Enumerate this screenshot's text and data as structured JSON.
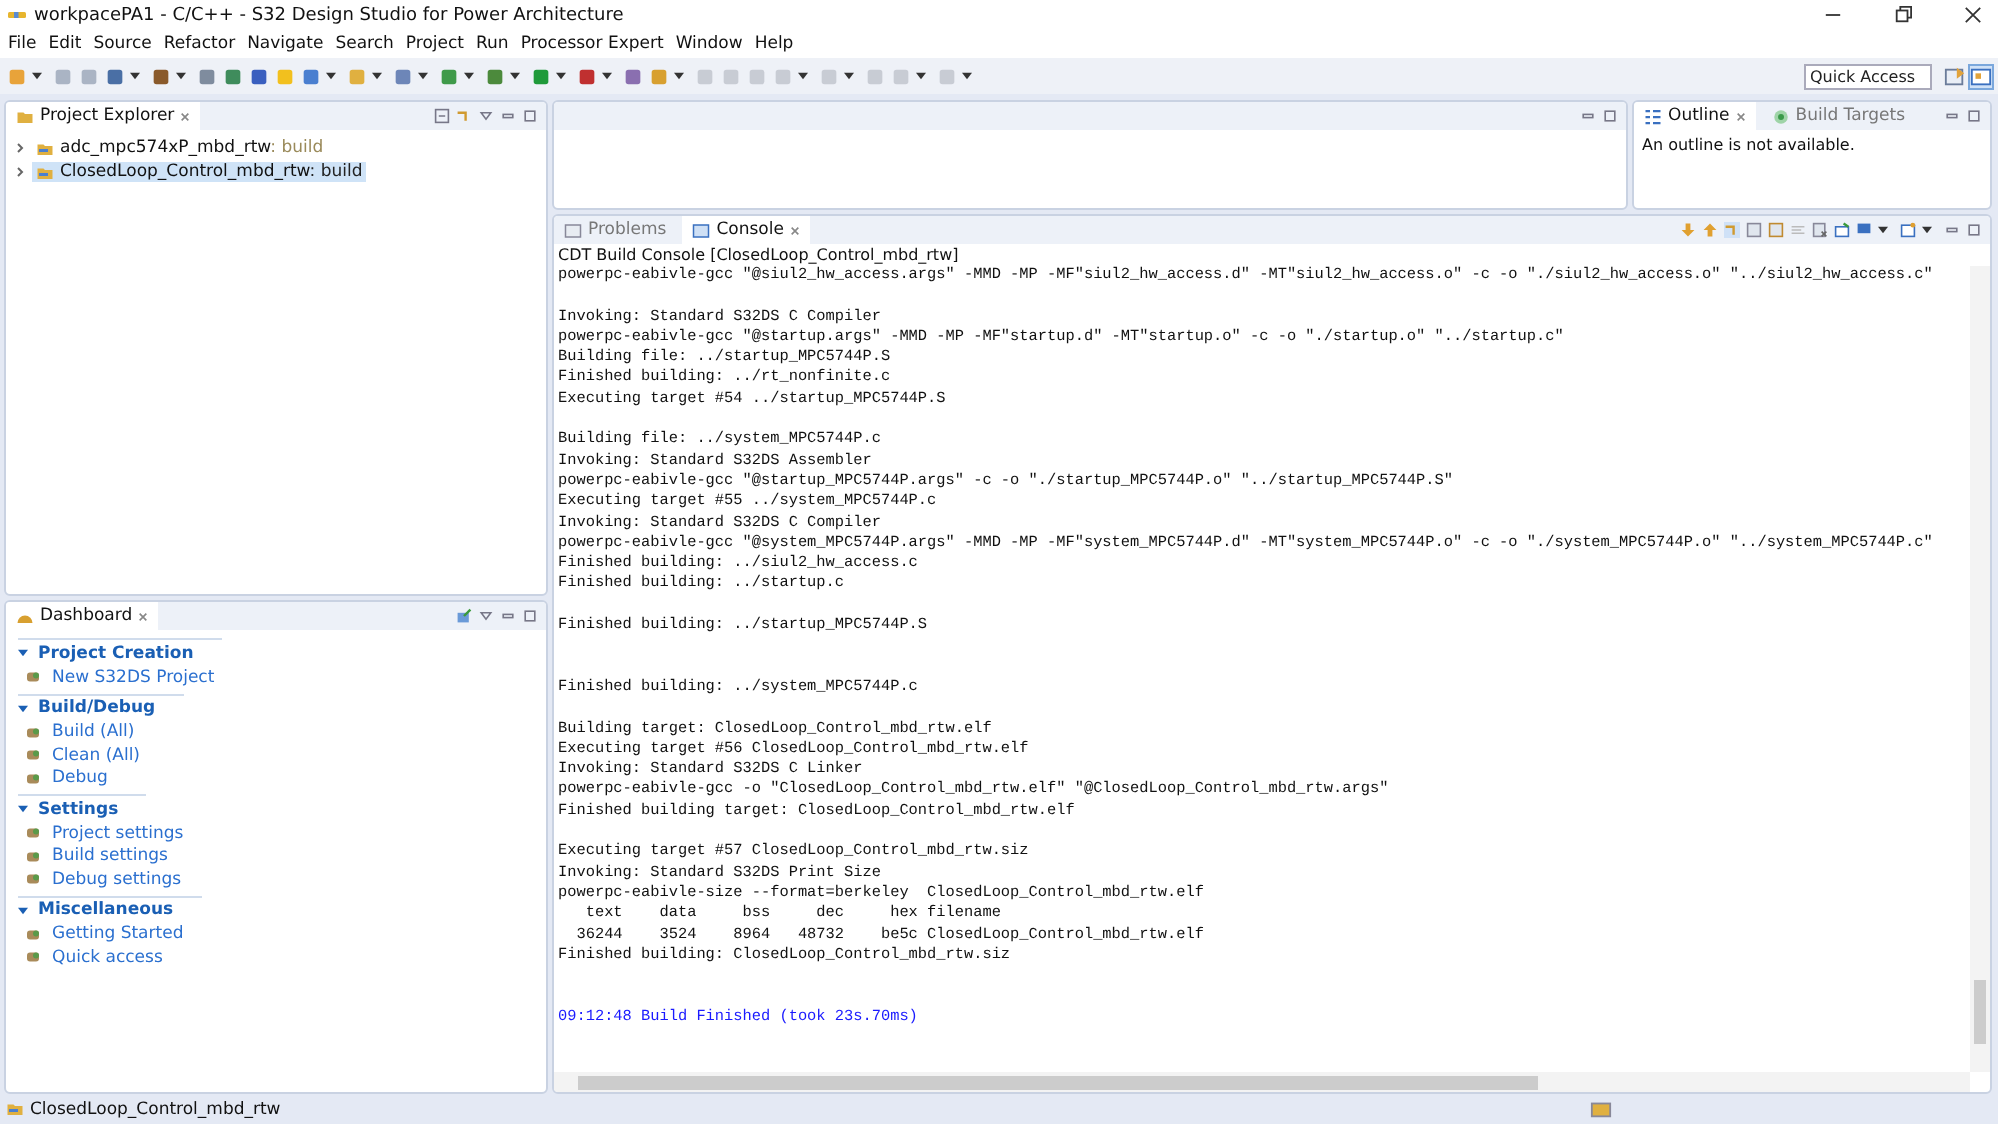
{
  "window": {
    "title": "workpacePA1 - C/C++ - S32 Design Studio for Power Architecture"
  },
  "menu": [
    "File",
    "Edit",
    "Source",
    "Refactor",
    "Navigate",
    "Search",
    "Project",
    "Run",
    "Processor Expert",
    "Window",
    "Help"
  ],
  "quick_access": {
    "placeholder": "Quick Access"
  },
  "project_explorer": {
    "title": "Project Explorer",
    "items": [
      {
        "name": "adc_mpc574xP_mbd_rtw",
        "decoration": ": build",
        "selected": false,
        "expanded": false
      },
      {
        "name": "ClosedLoop_Control_mbd_rtw",
        "decoration": ": build",
        "selected": true,
        "expanded": false
      }
    ]
  },
  "outline": {
    "tabs": [
      {
        "label": "Outline",
        "selected": true
      },
      {
        "label": "Build Targets",
        "selected": false
      }
    ],
    "message": "An outline is not available."
  },
  "dashboard": {
    "title": "Dashboard",
    "sections": [
      {
        "title": "Project Creation",
        "expanded": true,
        "items": [
          "New S32DS Project"
        ]
      },
      {
        "title": "Build/Debug",
        "expanded": true,
        "items": [
          "Build  (All)",
          "Clean  (All)",
          "Debug"
        ]
      },
      {
        "title": "Settings",
        "expanded": true,
        "items": [
          "Project settings",
          "Build settings",
          "Debug settings"
        ]
      },
      {
        "title": "Miscellaneous",
        "expanded": true,
        "items": [
          "Getting Started",
          "Quick access"
        ]
      }
    ]
  },
  "console_tabs": [
    {
      "label": "Problems",
      "selected": false
    },
    {
      "label": "Console",
      "selected": true
    }
  ],
  "console": {
    "title": "CDT Build Console [ClosedLoop_Control_mbd_rtw]",
    "lines": [
      {
        "kind": "text",
        "text": "powerpc-eabivle-gcc \"@siul2_hw_access.args\" -MMD -MP -MF\"siul2_hw_access.d\" -MT\"siul2_hw_access.o\" -c -o \"./siul2_hw_access.o\" \"../siul2_hw_access.c\""
      },
      {
        "kind": "blank"
      },
      {
        "kind": "text",
        "text": "Invoking: Standard S32DS C Compiler"
      },
      {
        "kind": "text",
        "text": "powerpc-eabivle-gcc \"@startup.args\" -MMD -MP -MF\"startup.d\" -MT\"startup.o\" -c -o \"./startup.o\" \"../startup.c\""
      },
      {
        "kind": "text",
        "text": "Building file: ../startup_MPC5744P.S"
      },
      {
        "kind": "text",
        "text": "Finished building: ../rt_nonfinite.c"
      },
      {
        "kind": "text",
        "text": "Executing target #54 ../startup_MPC5744P.S"
      },
      {
        "kind": "blank"
      },
      {
        "kind": "text",
        "text": "Building file: ../system_MPC5744P.c"
      },
      {
        "kind": "text",
        "text": "Invoking: Standard S32DS Assembler"
      },
      {
        "kind": "text",
        "text": "powerpc-eabivle-gcc \"@startup_MPC5744P.args\" -c -o \"./startup_MPC5744P.o\" \"../startup_MPC5744P.S\""
      },
      {
        "kind": "text",
        "text": "Executing target #55 ../system_MPC5744P.c"
      },
      {
        "kind": "text",
        "text": "Invoking: Standard S32DS C Compiler"
      },
      {
        "kind": "text",
        "text": "powerpc-eabivle-gcc \"@system_MPC5744P.args\" -MMD -MP -MF\"system_MPC5744P.d\" -MT\"system_MPC5744P.o\" -c -o \"./system_MPC5744P.o\" \"../system_MPC5744P.c\""
      },
      {
        "kind": "text",
        "text": "Finished building: ../siul2_hw_access.c"
      },
      {
        "kind": "text",
        "text": "Finished building: ../startup.c"
      },
      {
        "kind": "blank"
      },
      {
        "kind": "text",
        "text": "Finished building: ../startup_MPC5744P.S"
      },
      {
        "kind": "blank"
      },
      {
        "kind": "blank"
      },
      {
        "kind": "text",
        "text": "Finished building: ../system_MPC5744P.c"
      },
      {
        "kind": "blank"
      },
      {
        "kind": "text",
        "text": "Building target: ClosedLoop_Control_mbd_rtw.elf"
      },
      {
        "kind": "text",
        "text": "Executing target #56 ClosedLoop_Control_mbd_rtw.elf"
      },
      {
        "kind": "text",
        "text": "Invoking: Standard S32DS C Linker"
      },
      {
        "kind": "text",
        "text": "powerpc-eabivle-gcc -o \"ClosedLoop_Control_mbd_rtw.elf\" \"@ClosedLoop_Control_mbd_rtw.args\""
      },
      {
        "kind": "text",
        "text": "Finished building target: ClosedLoop_Control_mbd_rtw.elf"
      },
      {
        "kind": "blank"
      },
      {
        "kind": "text",
        "text": "Executing target #57 ClosedLoop_Control_mbd_rtw.siz"
      },
      {
        "kind": "text",
        "text": "Invoking: Standard S32DS Print Size"
      },
      {
        "kind": "text",
        "text": "powerpc-eabivle-size --format=berkeley  ClosedLoop_Control_mbd_rtw.elf"
      },
      {
        "kind": "text",
        "text": "   text    data     bss     dec     hex filename"
      },
      {
        "kind": "text",
        "text": "  36244    3524    8964   48732    be5c ClosedLoop_Control_mbd_rtw.elf"
      },
      {
        "kind": "text",
        "text": "Finished building: ClosedLoop_Control_mbd_rtw.siz"
      },
      {
        "kind": "blank"
      },
      {
        "kind": "blank"
      },
      {
        "kind": "status",
        "text": "09:12:48 Build Finished (took 23s.70ms)"
      }
    ]
  },
  "status_bar": {
    "text": "ClosedLoop_Control_mbd_rtw"
  }
}
